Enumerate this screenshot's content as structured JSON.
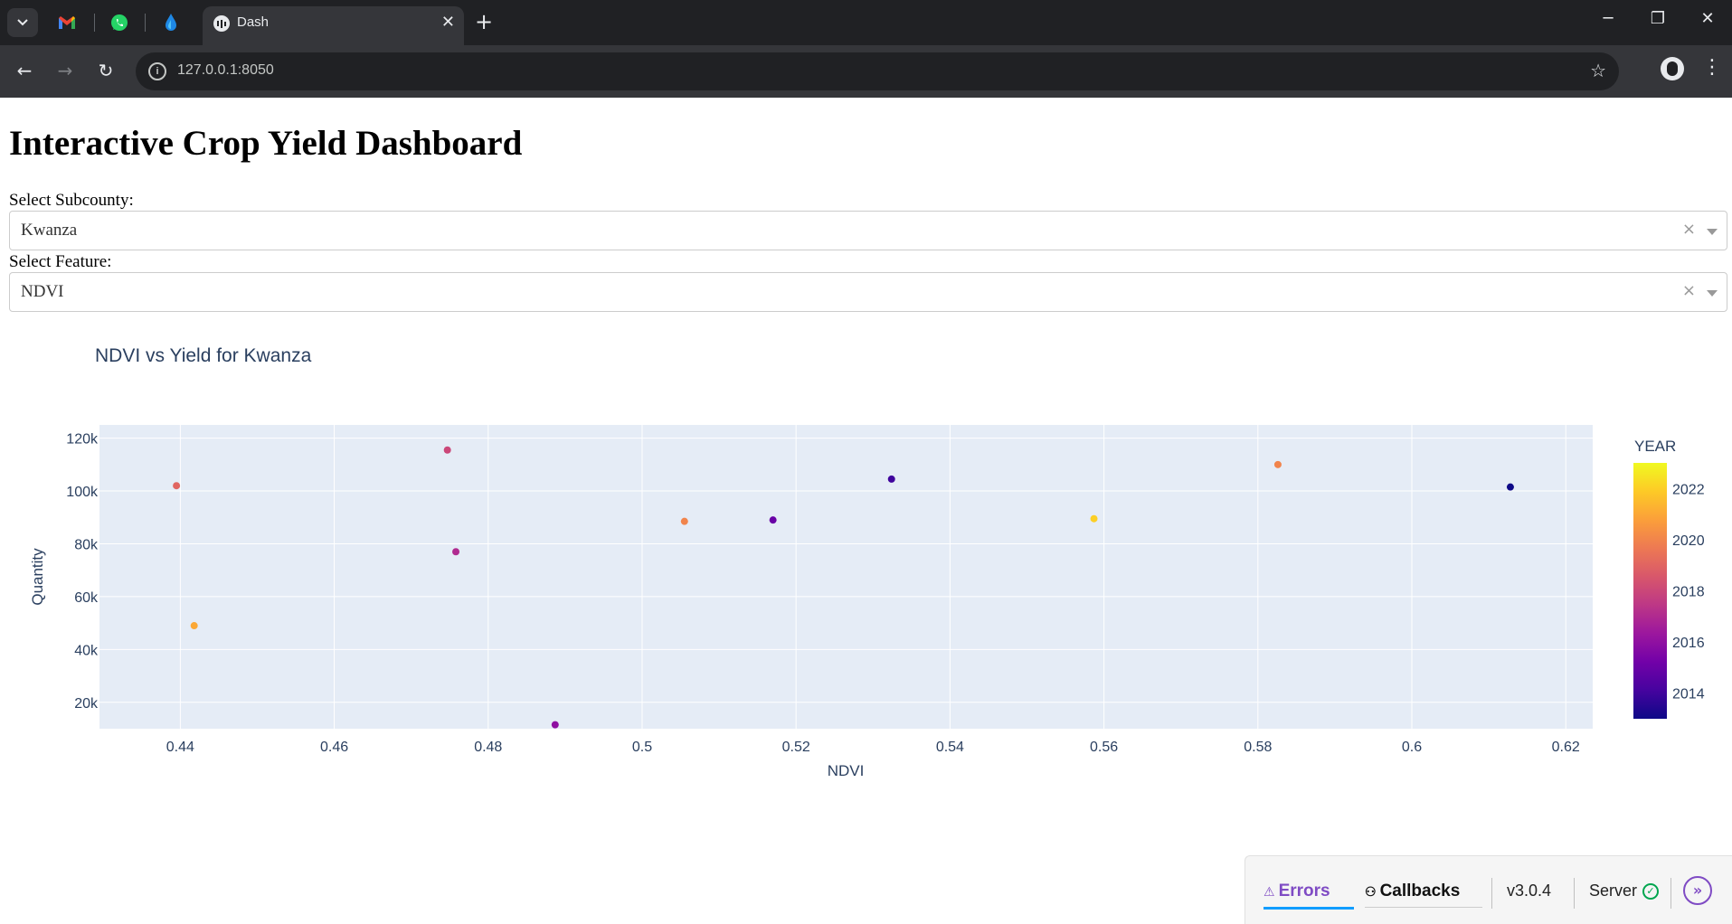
{
  "browser": {
    "tab_title": "Dash",
    "url": "127.0.0.1:8050",
    "pinned_tabs": [
      "gmail-icon",
      "whatsapp-icon",
      "drop-icon"
    ]
  },
  "page": {
    "title": "Interactive Crop Yield Dashboard",
    "subcounty_label": "Select Subcounty:",
    "subcounty_value": "Kwanza",
    "feature_label": "Select Feature:",
    "feature_value": "NDVI",
    "clear_symbol": "×"
  },
  "chart_data": {
    "type": "scatter",
    "title": "NDVI vs Yield for Kwanza",
    "xlabel": "NDVI",
    "ylabel": "Quantity",
    "xlim": [
      0.4295,
      0.6235
    ],
    "ylim": [
      10000,
      125000
    ],
    "x_ticks": [
      0.44,
      0.46,
      0.48,
      0.5,
      0.52,
      0.54,
      0.56,
      0.58,
      0.6,
      0.62
    ],
    "x_tick_labels": [
      "0.44",
      "0.46",
      "0.48",
      "0.5",
      "0.52",
      "0.54",
      "0.56",
      "0.58",
      "0.6",
      "0.62"
    ],
    "y_ticks": [
      20000,
      40000,
      60000,
      80000,
      100000,
      120000
    ],
    "y_tick_labels": [
      "20k",
      "40k",
      "60k",
      "80k",
      "100k",
      "120k"
    ],
    "grid": true,
    "colorbar": {
      "title": "YEAR",
      "range": [
        2013,
        2023
      ],
      "ticks": [
        2014,
        2016,
        2018,
        2020,
        2022
      ],
      "colors": [
        "#0d0887",
        "#46039f",
        "#7201a8",
        "#9c179e",
        "#bd3786",
        "#d8576b",
        "#ed7953",
        "#fb9f3a",
        "#fdca26",
        "#f0f921"
      ]
    },
    "points": [
      {
        "x": 0.4395,
        "y": 102000,
        "year": 2019
      },
      {
        "x": 0.4418,
        "y": 49000,
        "year": 2021
      },
      {
        "x": 0.4747,
        "y": 115500,
        "year": 2018
      },
      {
        "x": 0.4758,
        "y": 77000,
        "year": 2017
      },
      {
        "x": 0.4887,
        "y": 11500,
        "year": 2016
      },
      {
        "x": 0.5055,
        "y": 88500,
        "year": 2020
      },
      {
        "x": 0.517,
        "y": 89000,
        "year": 2015
      },
      {
        "x": 0.5324,
        "y": 104500,
        "year": 2014
      },
      {
        "x": 0.5587,
        "y": 89500,
        "year": 2022
      },
      {
        "x": 0.5826,
        "y": 110000,
        "year": 2020
      },
      {
        "x": 0.6128,
        "y": 101500,
        "year": 2013
      }
    ]
  },
  "devtools": {
    "errors_label": "Errors",
    "callbacks_label": "Callbacks",
    "version": "v3.0.4",
    "server_label": "Server"
  }
}
